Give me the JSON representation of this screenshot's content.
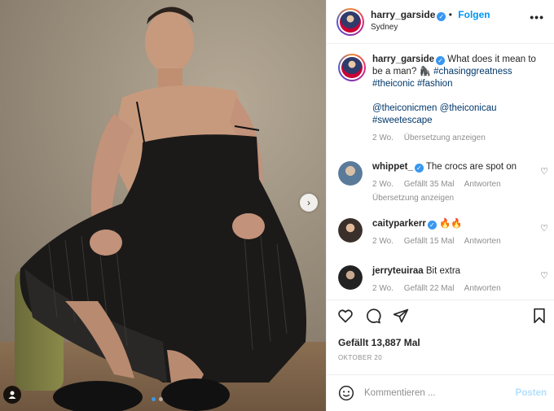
{
  "post": {
    "author": "harry_garside",
    "follow_label": "Folgen",
    "location": "Sydney",
    "caption_text": "What does it mean to be a man? 🦍",
    "caption_tags": [
      "#chasinggreatness",
      "#theiconic",
      "#fashion"
    ],
    "caption_mentions": [
      "@theiconicmen",
      "@theiconicau"
    ],
    "caption_tail_tag": "#sweetescape",
    "caption_age": "2 Wo.",
    "caption_translate": "Übersetzung anzeigen"
  },
  "comments": [
    {
      "user": "whippet_",
      "verified": true,
      "text": "The crocs are spot on",
      "age": "2 Wo.",
      "likes": "Gefällt 35 Mal",
      "reply": "Antworten",
      "translate": "Übersetzung anzeigen"
    },
    {
      "user": "caityparkerr",
      "verified": true,
      "text": "🔥🔥",
      "age": "2 Wo.",
      "likes": "Gefällt 15 Mal",
      "reply": "Antworten"
    },
    {
      "user": "jerryteuiraa",
      "verified": false,
      "text": "Bit extra",
      "age": "2 Wo.",
      "likes": "Gefällt 22 Mal",
      "reply": "Antworten"
    }
  ],
  "engagement": {
    "likes": "Gefällt 13,887 Mal",
    "date": "OKTOBER 20"
  },
  "composer": {
    "placeholder": "Kommentieren ...",
    "post_label": "Posten"
  },
  "carousel": {
    "count": 2,
    "active": 0
  },
  "colors": {
    "accent": "#0095f6",
    "verified": "#3897f0",
    "link": "#00376b",
    "muted": "#8e8e8e"
  },
  "icons": {
    "more": "more-horizontal-icon",
    "like": "heart-icon",
    "comment": "comment-icon",
    "share": "send-icon",
    "save": "bookmark-icon",
    "emoji": "smiley-icon",
    "next": "chevron-right-icon",
    "tag": "user-tag-icon"
  }
}
